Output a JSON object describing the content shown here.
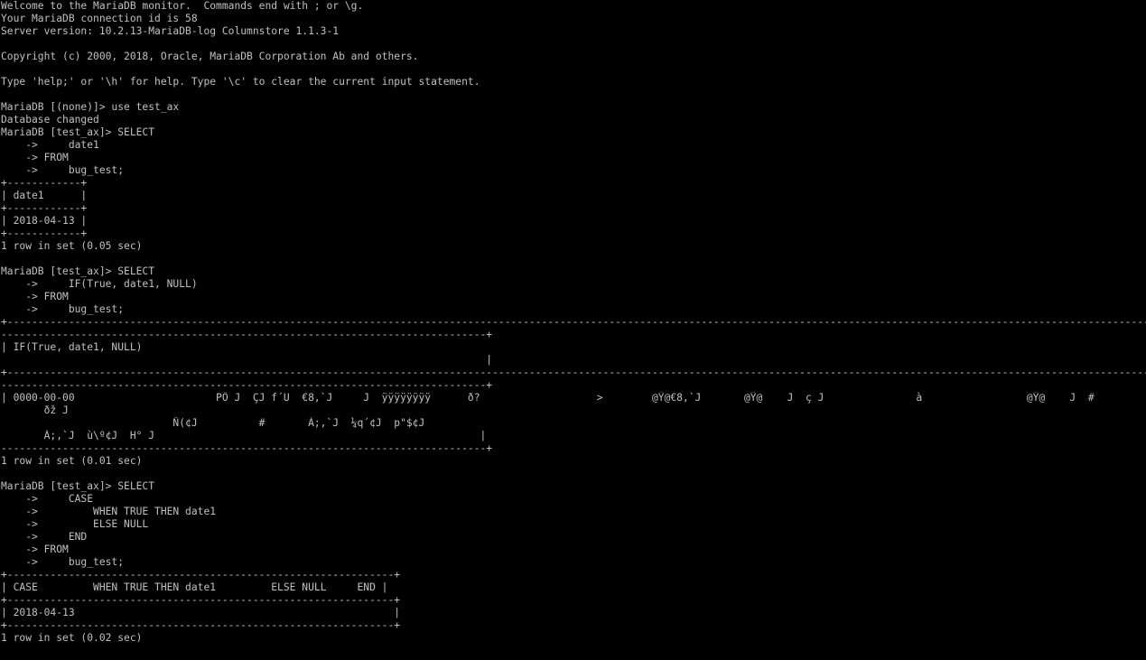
{
  "terminal": {
    "foreground": "#c0c0c0",
    "background": "#000000",
    "lines": [
      "Welcome to the MariaDB monitor.  Commands end with ; or \\g.",
      "Your MariaDB connection id is 58",
      "Server version: 10.2.13-MariaDB-log Columnstore 1.1.3-1",
      "",
      "Copyright (c) 2000, 2018, Oracle, MariaDB Corporation Ab and others.",
      "",
      "Type 'help;' or '\\h' for help. Type '\\c' to clear the current input statement.",
      "",
      "MariaDB [(none)]> use test_ax",
      "Database changed",
      "MariaDB [test_ax]> SELECT",
      "    ->     date1",
      "    -> FROM",
      "    ->     bug_test;",
      "+------------+",
      "| date1      |",
      "+------------+",
      "| 2018-04-13 |",
      "+------------+",
      "1 row in set (0.05 sec)",
      "",
      "MariaDB [test_ax]> SELECT",
      "    ->     IF(True, date1, NULL)",
      "    -> FROM",
      "    ->     bug_test;",
      "+-----------------------------------------------------------------------------------------------------------------------------------------------------------------------------------------------------",
      "-------------------------------------------------------------------------------+",
      "| IF(True, date1, NULL)",
      "                                                                               |",
      "+-----------------------------------------------------------------------------------------------------------------------------------------------------------------------------------------------------",
      "-------------------------------------------------------------------------------+",
      "| 0000-00-00                       PÖ J  ÇJ f´U  €8,`J     J  ÿÿÿÿÿÿÿÿ      ð?                   >        @Ÿ@€8,`J       @Ÿ@    J  ç J               à                 @Ÿ@    J  #",
      "       ðž J",
      "                            Ñ(¢J          #       À;,`J  ¼q´¢J  p\"$¢J",
      "       À;,`J  ù\\º¢J  H° J                                                     |",
      "-------------------------------------------------------------------------------+",
      "1 row in set (0.01 sec)",
      "",
      "MariaDB [test_ax]> SELECT",
      "    ->     CASE",
      "    ->         WHEN TRUE THEN date1",
      "    ->         ELSE NULL",
      "    ->     END",
      "    -> FROM",
      "    ->     bug_test;",
      "+---------------------------------------------------------------+",
      "| CASE         WHEN TRUE THEN date1         ELSE NULL     END |",
      "+---------------------------------------------------------------+",
      "| 2018-04-13                                                    |",
      "+---------------------------------------------------------------+",
      "1 row in set (0.02 sec)",
      ""
    ]
  }
}
